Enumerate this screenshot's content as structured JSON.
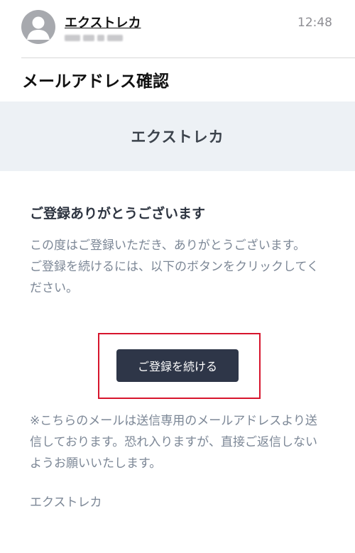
{
  "header": {
    "sender": "エクストレカ",
    "time": "12:48"
  },
  "subject": "メールアドレス確認",
  "banner": {
    "title": "エクストレカ"
  },
  "body": {
    "title": "ご登録ありがとうございます",
    "paragraph1": "この度はご登録いただき、ありがとうございます。\nご登録を続けるには、以下のボタンをクリックしてください。",
    "button_label": "ご登録を続ける",
    "paragraph2": "※こちらのメールは送信専用のメールアドレスより送信しております。恐れ入りますが、直接ご返信しないようお願いいたします。",
    "signature": "エクストレカ"
  },
  "colors": {
    "button_bg": "#2e3648",
    "highlight": "#d7152d",
    "banner_bg": "#edf1f5",
    "body_text": "#7c8796"
  }
}
